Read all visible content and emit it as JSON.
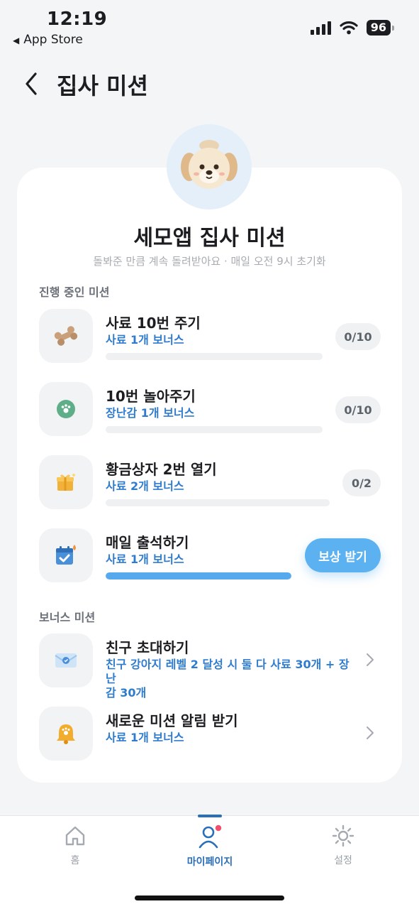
{
  "status": {
    "time": "12:19",
    "back_app": "App Store",
    "battery": "96"
  },
  "header": {
    "title": "집사 미션"
  },
  "card": {
    "title": "세모앱 집사 미션",
    "subtitle": "돌봐준 만큼 계속 돌려받아요 · 매일 오전 9시 초기화"
  },
  "sections": {
    "in_progress": "진행 중인 미션",
    "bonus": "보너스 미션"
  },
  "missions": [
    {
      "title": "사료 10번 주기",
      "reward": "사료 1개 보너스",
      "progress_text": "0/10",
      "progress": 0,
      "icon": "bone-icon"
    },
    {
      "title": "10번 놀아주기",
      "reward": "장난감 1개 보너스",
      "progress_text": "0/10",
      "progress": 0,
      "icon": "ball-icon"
    },
    {
      "title": "황금상자 2번 열기",
      "reward": "사료 2개 보너스",
      "progress_text": "0/2",
      "progress": 0,
      "icon": "gift-box-icon"
    },
    {
      "title": "매일 출석하기",
      "reward": "사료 1개 보너스",
      "action_label": "보상 받기",
      "progress": 1,
      "icon": "calendar-check-icon"
    }
  ],
  "bonus_missions": [
    {
      "title": "친구 초대하기",
      "reward": "친구 강아지 레벨 2 달성 시 둘 다 사료 30개 + 장난\n감 30개",
      "icon": "envelope-icon"
    },
    {
      "title": "새로운 미션 알림 받기",
      "reward": "사료 1개 보너스",
      "icon": "bell-icon"
    }
  ],
  "tabbar": {
    "home": "홈",
    "mypage": "마이페이지",
    "settings": "설정"
  },
  "colors": {
    "accent": "#5cb2f1",
    "link_blue": "#2f7ccf",
    "tab_active": "#2a6fb8",
    "notification_dot": "#f0506e"
  }
}
